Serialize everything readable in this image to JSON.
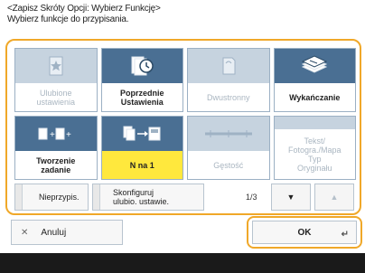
{
  "header": {
    "line1": "<Zapisz Skróty Opcji: Wybierz Funkcję>",
    "line2": "Wybierz funkcje do przypisania."
  },
  "functions": [
    {
      "label": "Ulubione\nustawienia",
      "state": "disabled",
      "icon": "star-doc-icon"
    },
    {
      "label": "Poprzednie\nUstawienia",
      "state": "active",
      "icon": "history-doc-icon"
    },
    {
      "label": "Dwustronny",
      "state": "disabled",
      "icon": "duplex-doc-icon"
    },
    {
      "label": "Wykańczanie",
      "state": "active",
      "icon": "finishing-stack-icon"
    },
    {
      "label": "Tworzenie\nzadanie",
      "state": "active",
      "icon": "job-build-icon"
    },
    {
      "label": "N na 1",
      "state": "active",
      "highlight": true,
      "icon": "n-on-1-icon"
    },
    {
      "label": "Gęstość",
      "state": "disabled",
      "icon": "density-slider-icon"
    },
    {
      "label": "Tekst/\nFotogra./Mapa\nTyp\nOryginału",
      "state": "disabled",
      "icon": "text-photo-map-icon"
    }
  ],
  "bottom": {
    "unassign_label": "Nieprzypis.",
    "configure_label": "Skonfiguruj\nulubio. ustawie.",
    "page_indicator": "1/3",
    "down_arrow": "▼",
    "up_arrow": "▲"
  },
  "actions": {
    "cancel_label": "Anuluj",
    "cancel_icon": "✕",
    "ok_label": "OK",
    "ok_icon": "↵"
  },
  "colors": {
    "accent": "#f0a829",
    "active_tile": "#4a6f93",
    "disabled_tile": "#c6d3df",
    "highlight": "#ffe83d"
  }
}
